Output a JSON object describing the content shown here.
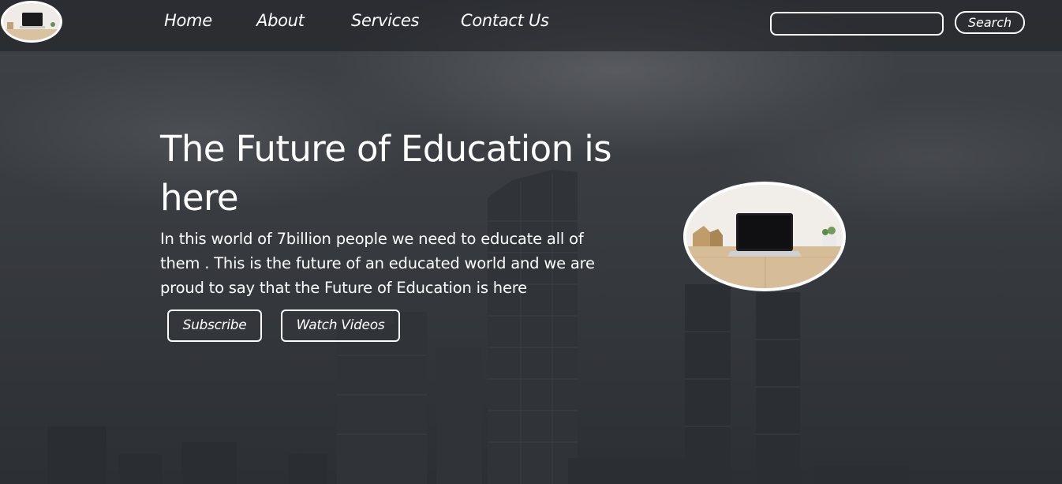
{
  "nav": {
    "logo_icon": "laptop-desk-photo",
    "links": [
      {
        "label": "Home"
      },
      {
        "label": "About"
      },
      {
        "label": "Services"
      },
      {
        "label": "Contact Us"
      }
    ],
    "search": {
      "placeholder": "",
      "value": "",
      "button_label": "Search"
    }
  },
  "hero": {
    "title": "The Future of Education is here",
    "text": "In this world of 7billion people we need to educate all of them . This is the future of an educated world and we are proud to say that the Future of Education is here",
    "buttons": {
      "subscribe": "Subscribe",
      "watch_videos": "Watch Videos"
    },
    "image_icon": "laptop-desk-photo"
  },
  "colors": {
    "text": "#ffffff",
    "nav_background": "#1c1e21",
    "background": "#35383d"
  }
}
